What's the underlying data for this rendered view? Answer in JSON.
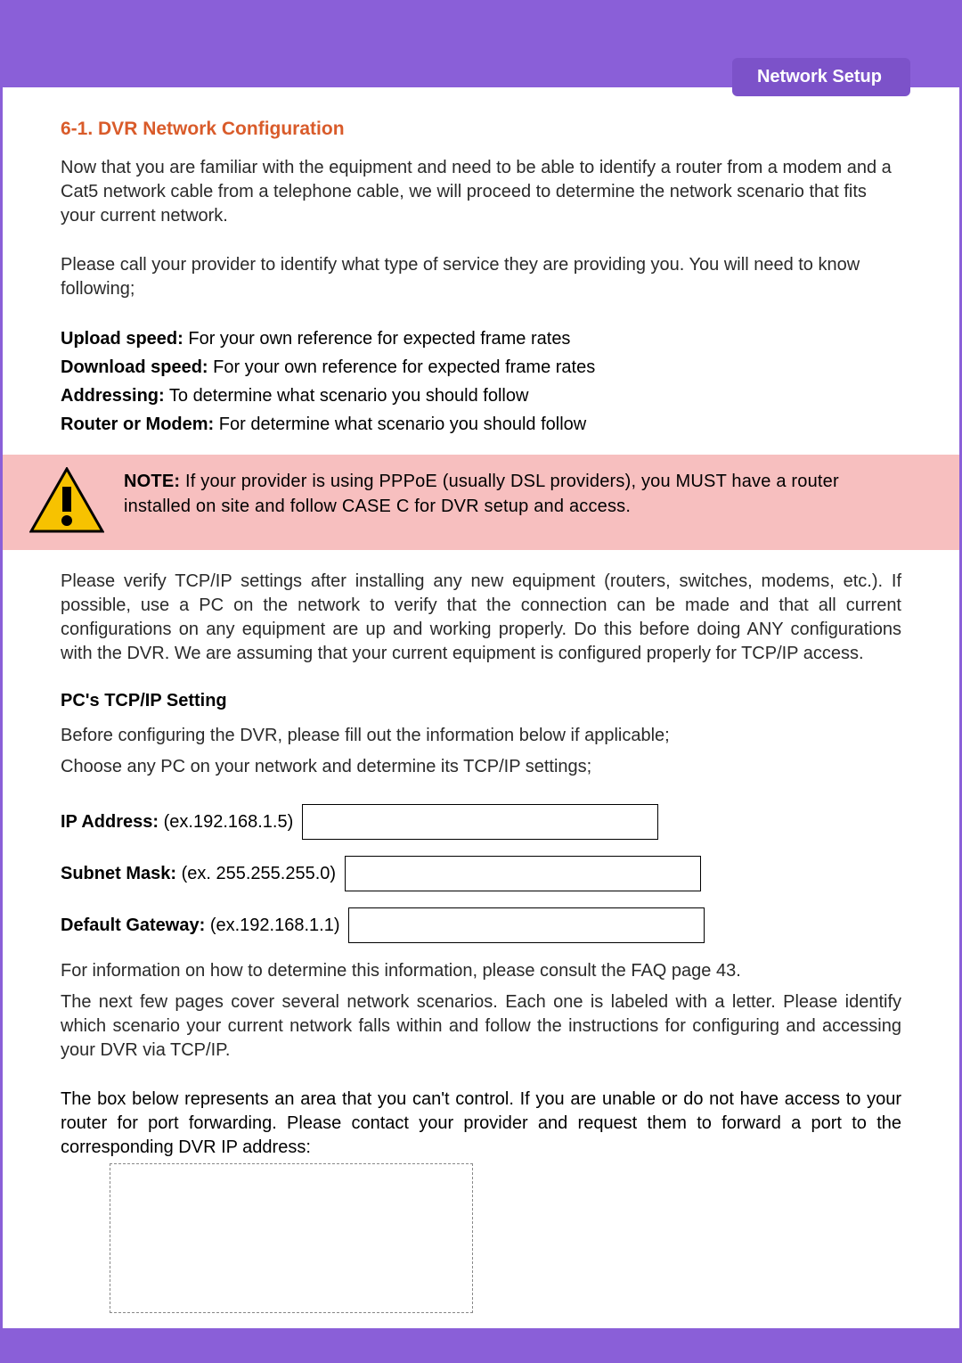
{
  "chapter_tab": "Network Setup",
  "section_title": "6-1. DVR Network Configuration",
  "intro_para": "Now that you are familiar with the equipment and need to be able to identify a router from a modem and a Cat5 network cable from a telephone cable, we will proceed to determine the network scenario that fits your current network.",
  "call_para": "Please call your provider to identify what type of service they are providing you. You will need to know following;",
  "lines": {
    "upload_label": "Upload speed:",
    "upload_text": " For your own reference for expected frame rates",
    "download_label": "Download speed:",
    "download_text": " For your own reference for expected frame rates",
    "addressing_label": "Addressing:",
    "addressing_text": " To determine what scenario you should follow",
    "routerm_label": "Router or Modem:",
    "routerm_text": " For determine what scenario you should follow"
  },
  "note": {
    "label": "NOTE:",
    "body1": " If your provider is using PPPoE (usually DSL providers), you MUST have a router installed on site and follow CASE C for DVR setup and access."
  },
  "verify_para": "Please verify TCP/IP settings after installing any new equipment (routers, switches, modems, etc.). If possible, use a PC on the network to verify that the connection can be made and that all current configurations on any equipment are up and working properly. Do this before doing ANY configurations with the DVR. We are assuming that your current equipment is configured properly for TCP/IP access.",
  "pc_head": "PC's TCP/IP Setting",
  "before_para": "Before configuring the DVR, please fill out the information below if applicable;",
  "choose_para": "Choose any PC on your network and determine its TCP/IP settings;",
  "fields": {
    "ip_label": "IP Address:",
    "ip_hint": " (ex.192.168.1.5)",
    "subnet_label": "Subnet Mask:",
    "subnet_hint": " (ex. 255.255.255.0)",
    "gateway_label": "Default Gateway:",
    "gateway_hint": " (ex.192.168.1.1)"
  },
  "info_para": "For information on how to determine this information, please consult the FAQ page 43.",
  "scenarios_para": "The next few pages cover several network scenarios. Each one is labeled with a letter. Please identify which scenario your current network falls within and follow the instructions for configuring and accessing your DVR via TCP/IP.",
  "box_para": "The box below represents an area that you can't control. If you are unable or do not have access to your router for port forwarding. Please contact your provider and request them to forward a port to the corresponding DVR IP address:"
}
